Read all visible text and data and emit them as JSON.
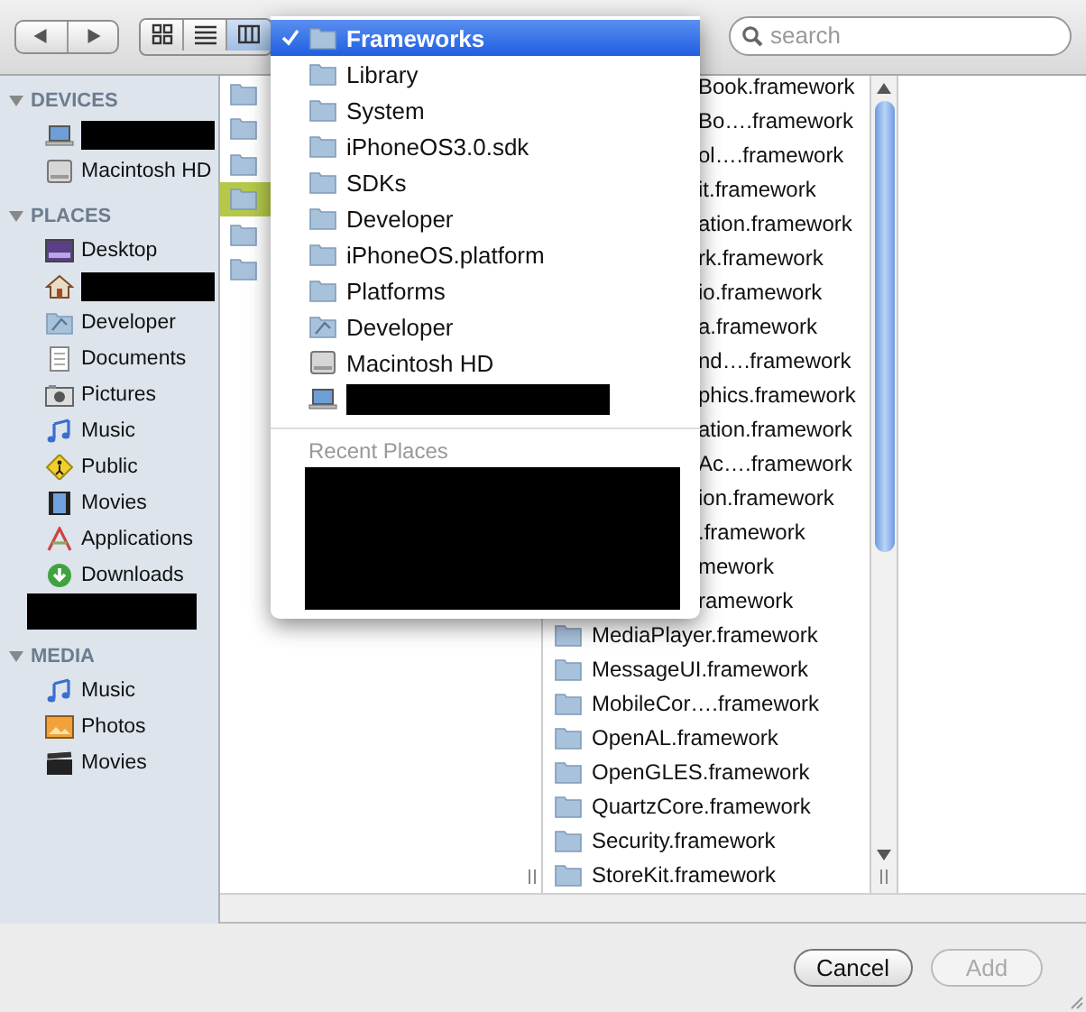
{
  "toolbar": {
    "view_buttons": [
      {
        "kind": "icons",
        "selected": false
      },
      {
        "kind": "list",
        "selected": false
      },
      {
        "kind": "columns",
        "selected": true
      }
    ],
    "search": {
      "placeholder": "search"
    }
  },
  "sidebar": {
    "sections": [
      {
        "title": "DEVICES",
        "expanded": true,
        "items": [
          {
            "kind": "laptop",
            "redacted": true
          },
          {
            "kind": "drive",
            "label": "Macintosh HD",
            "redacted": false
          }
        ]
      },
      {
        "title": "PLACES",
        "expanded": true,
        "items": [
          {
            "kind": "desktop",
            "label": "Desktop",
            "redacted": false
          },
          {
            "kind": "home",
            "redacted": true
          },
          {
            "kind": "developer",
            "label": "Developer",
            "redacted": false
          },
          {
            "kind": "documents",
            "label": "Documents",
            "redacted": false
          },
          {
            "kind": "pictures",
            "label": "Pictures",
            "redacted": false
          },
          {
            "kind": "music",
            "label": "Music",
            "redacted": false
          },
          {
            "kind": "public",
            "label": "Public",
            "redacted": false
          },
          {
            "kind": "movies",
            "label": "Movies",
            "redacted": false
          },
          {
            "kind": "applications",
            "label": "Applications",
            "redacted": false
          },
          {
            "kind": "downloads",
            "label": "Downloads",
            "redacted": false
          },
          {
            "kind": "none",
            "redacted": true
          }
        ]
      },
      {
        "title": "MEDIA",
        "expanded": true,
        "items": [
          {
            "kind": "music",
            "label": "Music",
            "redacted": false
          },
          {
            "kind": "photos",
            "label": "Photos",
            "redacted": false
          },
          {
            "kind": "clapper",
            "label": "Movies",
            "redacted": false
          }
        ]
      }
    ]
  },
  "column_1": {
    "items": [
      {
        "selected": false
      },
      {
        "selected": false
      },
      {
        "selected": false
      },
      {
        "selected": true
      },
      {
        "selected": false
      },
      {
        "selected": false
      }
    ]
  },
  "column_2": {
    "items": [
      {
        "kind": "partial",
        "label": "Book.framework"
      },
      {
        "kind": "partial",
        "label": "Bo….framework"
      },
      {
        "kind": "partial",
        "label": "ol….framework"
      },
      {
        "kind": "partial",
        "label": "it.framework"
      },
      {
        "kind": "partial",
        "label": "ation.framework"
      },
      {
        "kind": "partial",
        "label": "rk.framework"
      },
      {
        "kind": "partial",
        "label": "io.framework"
      },
      {
        "kind": "partial",
        "label": "a.framework"
      },
      {
        "kind": "partial",
        "label": "nd….framework"
      },
      {
        "kind": "partial",
        "label": "phics.framework"
      },
      {
        "kind": "partial",
        "label": "ation.framework"
      },
      {
        "kind": "partial",
        "label": "Ac….framework"
      },
      {
        "kind": "partial",
        "label": "ion.framework"
      },
      {
        "kind": "partial",
        "label": ".framework"
      },
      {
        "kind": "partial",
        "label": "mework"
      },
      {
        "kind": "partial",
        "label": "ramework"
      },
      {
        "kind": "full",
        "label": "MediaPlayer.framework"
      },
      {
        "kind": "full",
        "label": "MessageUI.framework"
      },
      {
        "kind": "full",
        "label": "MobileCor….framework"
      },
      {
        "kind": "full",
        "label": "OpenAL.framework"
      },
      {
        "kind": "full",
        "label": "OpenGLES.framework"
      },
      {
        "kind": "full",
        "label": "QuartzCore.framework"
      },
      {
        "kind": "full",
        "label": "Security.framework"
      },
      {
        "kind": "full",
        "label": "StoreKit.framework"
      }
    ]
  },
  "menu": {
    "items": [
      {
        "kind": "folder",
        "label": "Frameworks",
        "selected": true,
        "redacted": false
      },
      {
        "kind": "folder",
        "label": "Library",
        "selected": false,
        "redacted": false
      },
      {
        "kind": "folder",
        "label": "System",
        "selected": false,
        "redacted": false
      },
      {
        "kind": "folder",
        "label": "iPhoneOS3.0.sdk",
        "selected": false,
        "redacted": false
      },
      {
        "kind": "folder",
        "label": "SDKs",
        "selected": false,
        "redacted": false
      },
      {
        "kind": "folder",
        "label": "Developer",
        "selected": false,
        "redacted": false
      },
      {
        "kind": "folder",
        "label": "iPhoneOS.platform",
        "selected": false,
        "redacted": false
      },
      {
        "kind": "folder",
        "label": "Platforms",
        "selected": false,
        "redacted": false
      },
      {
        "kind": "developer",
        "label": "Developer",
        "selected": false,
        "redacted": false
      },
      {
        "kind": "drive",
        "label": "Macintosh HD",
        "selected": false,
        "redacted": false
      },
      {
        "kind": "laptop",
        "selected": false,
        "redacted": true
      }
    ],
    "recent_header": "Recent Places"
  },
  "buttons": [
    {
      "label": "Cancel",
      "disabled": false
    },
    {
      "label": "Add",
      "disabled": true
    }
  ]
}
